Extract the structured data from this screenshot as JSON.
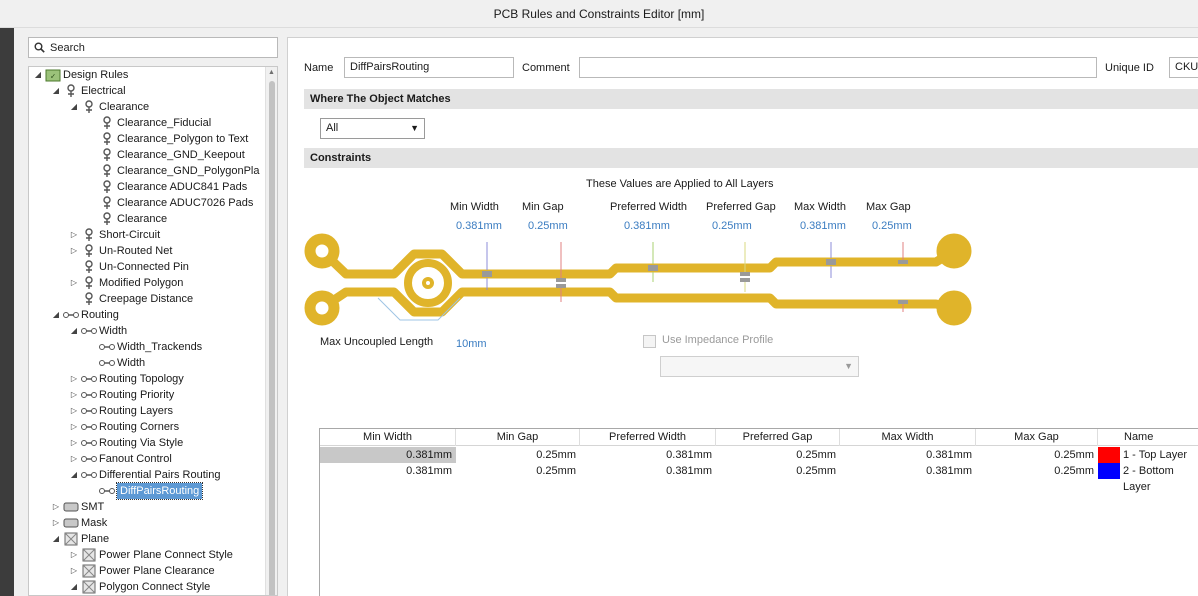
{
  "window": {
    "title": "PCB Rules and Constraints Editor [mm]"
  },
  "search": {
    "label": "Search"
  },
  "tree": [
    {
      "label": "Design Rules",
      "depth": 0,
      "exp": "collapse",
      "icon": "rules-root-icon"
    },
    {
      "label": "Electrical",
      "depth": 1,
      "exp": "collapse",
      "icon": "electrical-icon"
    },
    {
      "label": "Clearance",
      "depth": 2,
      "exp": "collapse",
      "icon": "clearance-icon"
    },
    {
      "label": "Clearance_Fiducial",
      "depth": 3,
      "exp": "",
      "icon": "clearance-rule-icon"
    },
    {
      "label": "Clearance_Polygon to Text",
      "depth": 3,
      "exp": "",
      "icon": "clearance-rule-icon"
    },
    {
      "label": "Clearance_GND_Keepout",
      "depth": 3,
      "exp": "",
      "icon": "clearance-rule-icon"
    },
    {
      "label": "Clearance_GND_PolygonPla",
      "depth": 3,
      "exp": "",
      "icon": "clearance-rule-icon"
    },
    {
      "label": "Clearance ADUC841 Pads",
      "depth": 3,
      "exp": "",
      "icon": "clearance-rule-icon"
    },
    {
      "label": "Clearance ADUC7026 Pads",
      "depth": 3,
      "exp": "",
      "icon": "clearance-rule-icon"
    },
    {
      "label": "Clearance",
      "depth": 3,
      "exp": "",
      "icon": "clearance-rule-icon"
    },
    {
      "label": "Short-Circuit",
      "depth": 2,
      "exp": "expand",
      "icon": "short-circuit-icon"
    },
    {
      "label": "Un-Routed Net",
      "depth": 2,
      "exp": "expand",
      "icon": "unrouted-net-icon"
    },
    {
      "label": "Un-Connected Pin",
      "depth": 2,
      "exp": "",
      "icon": "unconnected-pin-icon"
    },
    {
      "label": "Modified Polygon",
      "depth": 2,
      "exp": "expand",
      "icon": "modified-polygon-icon"
    },
    {
      "label": "Creepage Distance",
      "depth": 2,
      "exp": "",
      "icon": "creepage-icon"
    },
    {
      "label": "Routing",
      "depth": 1,
      "exp": "collapse",
      "icon": "routing-icon"
    },
    {
      "label": "Width",
      "depth": 2,
      "exp": "collapse",
      "icon": "width-icon"
    },
    {
      "label": "Width_Trackends",
      "depth": 3,
      "exp": "",
      "icon": "width-rule-icon"
    },
    {
      "label": "Width",
      "depth": 3,
      "exp": "",
      "icon": "width-rule-icon"
    },
    {
      "label": "Routing Topology",
      "depth": 2,
      "exp": "expand",
      "icon": "routing-topology-icon"
    },
    {
      "label": "Routing Priority",
      "depth": 2,
      "exp": "expand",
      "icon": "routing-priority-icon"
    },
    {
      "label": "Routing Layers",
      "depth": 2,
      "exp": "expand",
      "icon": "routing-layers-icon"
    },
    {
      "label": "Routing Corners",
      "depth": 2,
      "exp": "expand",
      "icon": "routing-corners-icon"
    },
    {
      "label": "Routing Via Style",
      "depth": 2,
      "exp": "expand",
      "icon": "routing-via-icon"
    },
    {
      "label": "Fanout Control",
      "depth": 2,
      "exp": "expand",
      "icon": "fanout-icon"
    },
    {
      "label": "Differential Pairs Routing",
      "depth": 2,
      "exp": "collapse",
      "icon": "diff-pairs-icon"
    },
    {
      "label": "DiffPairsRouting",
      "depth": 3,
      "exp": "",
      "icon": "diff-pairs-rule-icon",
      "selected": true
    },
    {
      "label": "SMT",
      "depth": 1,
      "exp": "expand",
      "icon": "smt-icon"
    },
    {
      "label": "Mask",
      "depth": 1,
      "exp": "expand",
      "icon": "mask-icon"
    },
    {
      "label": "Plane",
      "depth": 1,
      "exp": "collapse",
      "icon": "plane-icon"
    },
    {
      "label": "Power Plane Connect Style",
      "depth": 2,
      "exp": "expand",
      "icon": "plane-connect-icon"
    },
    {
      "label": "Power Plane Clearance",
      "depth": 2,
      "exp": "expand",
      "icon": "plane-clearance-icon"
    },
    {
      "label": "Polygon Connect Style",
      "depth": 2,
      "exp": "collapse",
      "icon": "polygon-connect-icon"
    }
  ],
  "rule": {
    "name_label": "Name",
    "name_value": "DiffPairsRouting",
    "comment_label": "Comment",
    "comment_value": "",
    "uid_label": "Unique ID",
    "uid_value": "CKUH"
  },
  "match": {
    "section_title": "Where The Object Matches",
    "selected": "All"
  },
  "constraints": {
    "section_title": "Constraints",
    "applied_note": "These Values are Applied to All Layers",
    "min_width_label": "Min Width",
    "min_width_value": "0.381mm",
    "min_gap_label": "Min Gap",
    "min_gap_value": "0.25mm",
    "pref_width_label": "Preferred Width",
    "pref_width_value": "0.381mm",
    "pref_gap_label": "Preferred Gap",
    "pref_gap_value": "0.25mm",
    "max_width_label": "Max Width",
    "max_width_value": "0.381mm",
    "max_gap_label": "Max Gap",
    "max_gap_value": "0.25mm",
    "uncoupled_label": "Max Uncoupled Length",
    "uncoupled_value": "10mm",
    "impedance_label": "Use Impedance Profile",
    "impedance_checked": false,
    "trace_color": "#e0b42a"
  },
  "layer_table": {
    "headers": [
      "Min Width",
      "Min Gap",
      "Preferred Width",
      "Preferred Gap",
      "Max Width",
      "Max Gap",
      "Name"
    ],
    "rows": [
      {
        "values": [
          "0.381mm",
          "0.25mm",
          "0.381mm",
          "0.25mm",
          "0.381mm",
          "0.25mm"
        ],
        "color": "#ff0000",
        "name": "1 - Top Layer"
      },
      {
        "values": [
          "0.381mm",
          "0.25mm",
          "0.381mm",
          "0.25mm",
          "0.381mm",
          "0.25mm"
        ],
        "color": "#0000ff",
        "name": "2 - Bottom Layer"
      }
    ]
  }
}
